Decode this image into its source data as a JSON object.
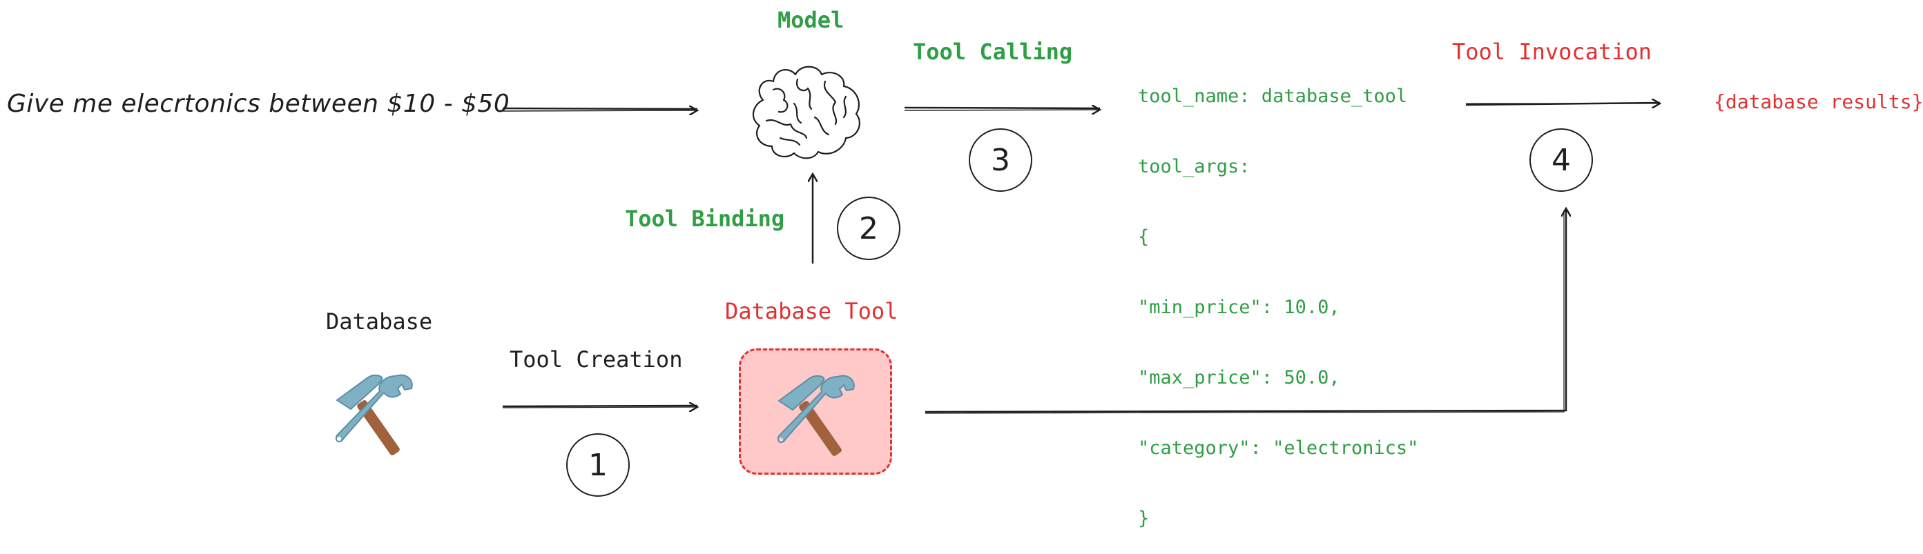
{
  "diagram": {
    "user_query": "Give me elecrtonics between $10 - $50",
    "model": {
      "label": "Model",
      "icon": "brain-icon"
    },
    "steps": [
      {
        "number": "1",
        "label": "Tool Creation"
      },
      {
        "number": "2",
        "label": "Tool Binding"
      },
      {
        "number": "3",
        "label": "Tool Calling"
      },
      {
        "number": "4",
        "label": "Tool Invocation"
      }
    ],
    "database": {
      "label": "Database",
      "icon": "hammer-and-wrench-icon"
    },
    "database_tool": {
      "label": "Database Tool",
      "icon": "hammer-and-wrench-icon"
    },
    "tool_call_output": [
      "tool_name: database_tool",
      "tool_args:",
      "{",
      "\"min_price\": 10.0,",
      "\"max_price\": 50.0,",
      "\"category\": \"electronics\"",
      "}"
    ],
    "result": "{database results}",
    "colors": {
      "green": "#2f9e44",
      "red": "#e03131",
      "ink": "#1e1e1e",
      "tool_box_fill": "#ffc9c9"
    }
  }
}
